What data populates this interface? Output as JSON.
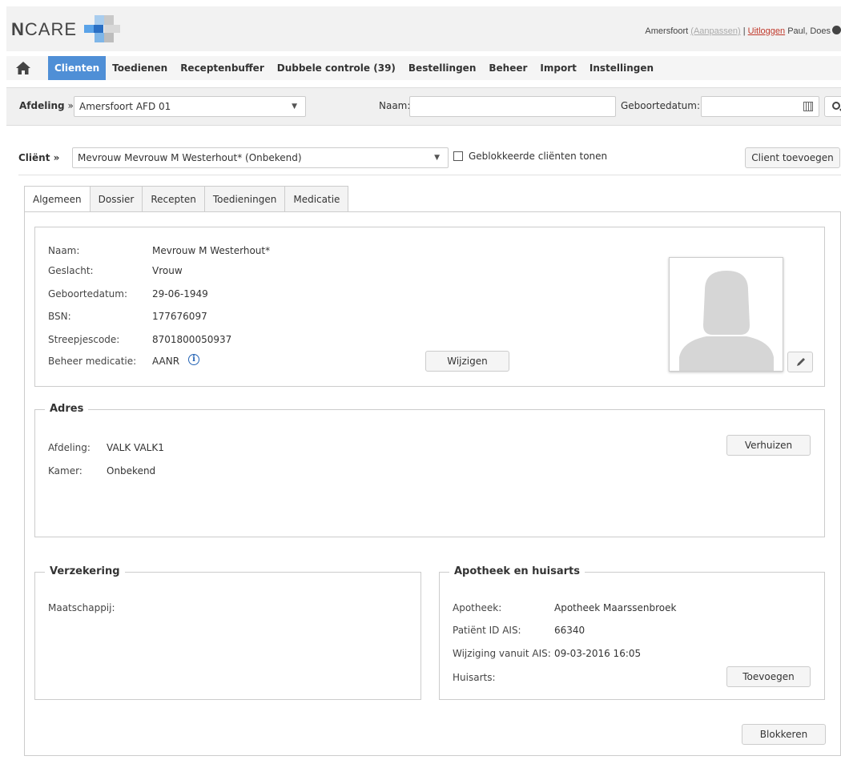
{
  "header": {
    "logo": "NCARE",
    "location": "Amersfoort",
    "adjust_link": "(Aanpassen)",
    "separator": "|",
    "logout_link": "Uitloggen",
    "user": "Paul, Does"
  },
  "nav": {
    "items": [
      {
        "label": "Clienten",
        "active": true
      },
      {
        "label": "Toedienen"
      },
      {
        "label": "Receptenbuffer"
      },
      {
        "label": "Dubbele controle (39)"
      },
      {
        "label": "Bestellingen"
      },
      {
        "label": "Beheer"
      },
      {
        "label": "Import"
      },
      {
        "label": "Instellingen"
      }
    ]
  },
  "filter": {
    "afdeling_label": "Afdeling »",
    "afdeling_value": "Amersfoort AFD 01",
    "naam_label": "Naam:",
    "naam_value": "",
    "geboortedatum_label": "Geboortedatum:",
    "geboortedatum_value": ""
  },
  "client": {
    "label": "Cliënt »",
    "selected": "Mevrouw Mevrouw M Westerhout* (Onbekend)",
    "blocked_checkbox_label": "Geblokkeerde cliënten tonen",
    "add_button": "Client toevoegen"
  },
  "tabs": [
    {
      "label": "Algemeen",
      "active": true
    },
    {
      "label": "Dossier"
    },
    {
      "label": "Recepten"
    },
    {
      "label": "Toedieningen"
    },
    {
      "label": "Medicatie"
    }
  ],
  "general": {
    "fields": [
      {
        "label": "Naam:",
        "value": "Mevrouw M Westerhout*"
      },
      {
        "label": "Geslacht:",
        "value": "Vrouw"
      },
      {
        "label": "Geboortedatum:",
        "value": "29-06-1949"
      },
      {
        "label": "BSN:",
        "value": "177676097"
      },
      {
        "label": "Streepjescode:",
        "value": "8701800050937"
      },
      {
        "label": "Beheer medicatie:",
        "value": "AANR"
      }
    ],
    "info_icon": "i",
    "edit_button": "Wijzigen"
  },
  "address": {
    "title": "Adres",
    "afdeling_label": "Afdeling:",
    "afdeling_value": "VALK VALK1",
    "kamer_label": "Kamer:",
    "kamer_value": "Onbekend",
    "move_button": "Verhuizen"
  },
  "insurance": {
    "title": "Verzekering",
    "maatschappij_label": "Maatschappij:"
  },
  "pharmacy": {
    "title": "Apotheek en huisarts",
    "apotheek_label": "Apotheek:",
    "apotheek_value": "Apotheek Maarssenbroek",
    "patient_id_label": "Patiënt ID AIS:",
    "patient_id_value": "66340",
    "wijziging_label": "Wijziging vanuit AIS:",
    "wijziging_value": "09-03-2016 16:05",
    "huisarts_label": "Huisarts:",
    "add_button": "Toevoegen"
  },
  "block_button": "Blokkeren",
  "colors": {
    "accent": "#4f8fd6",
    "logout": "#c0392b",
    "info": "#2463b5"
  }
}
